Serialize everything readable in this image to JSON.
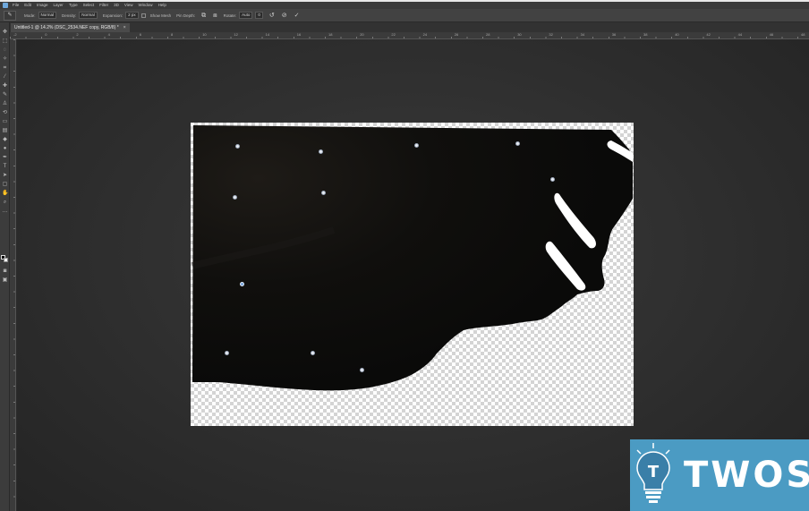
{
  "menubar": {
    "items": [
      "File",
      "Edit",
      "Image",
      "Layer",
      "Type",
      "Select",
      "Filter",
      "3D",
      "View",
      "Window",
      "Help"
    ]
  },
  "options": {
    "mode_label": "Mode:",
    "mode_value": "Normal",
    "density_label": "Density:",
    "density_value": "Normal",
    "expansion_label": "Expansion:",
    "expansion_value": "2 px",
    "show_mesh_label": "Show Mesh",
    "pin_depth_label": "Pin Depth:",
    "rotate_label": "Rotate:",
    "rotate_value": "Auto",
    "angle_value": "0"
  },
  "document": {
    "tab_title": "Untitled-1 @ 14.2% (DSC_2534.NEF copy, RGB/8) *",
    "close": "×"
  },
  "ruler": {
    "marks": [
      "-2",
      "0",
      "2",
      "4",
      "6",
      "8",
      "10",
      "12",
      "14",
      "16",
      "18",
      "20",
      "22",
      "24",
      "26",
      "28",
      "30",
      "32",
      "34",
      "36",
      "38",
      "40",
      "42",
      "44",
      "46",
      "48"
    ]
  },
  "watermark": {
    "text": "TWOS",
    "bulb_text": "T"
  },
  "colors": {
    "workspace": "#2b2b2b",
    "panel": "#424242",
    "watermark_bg": "#4b9bc3",
    "image_dark": "#0e0d0b"
  }
}
